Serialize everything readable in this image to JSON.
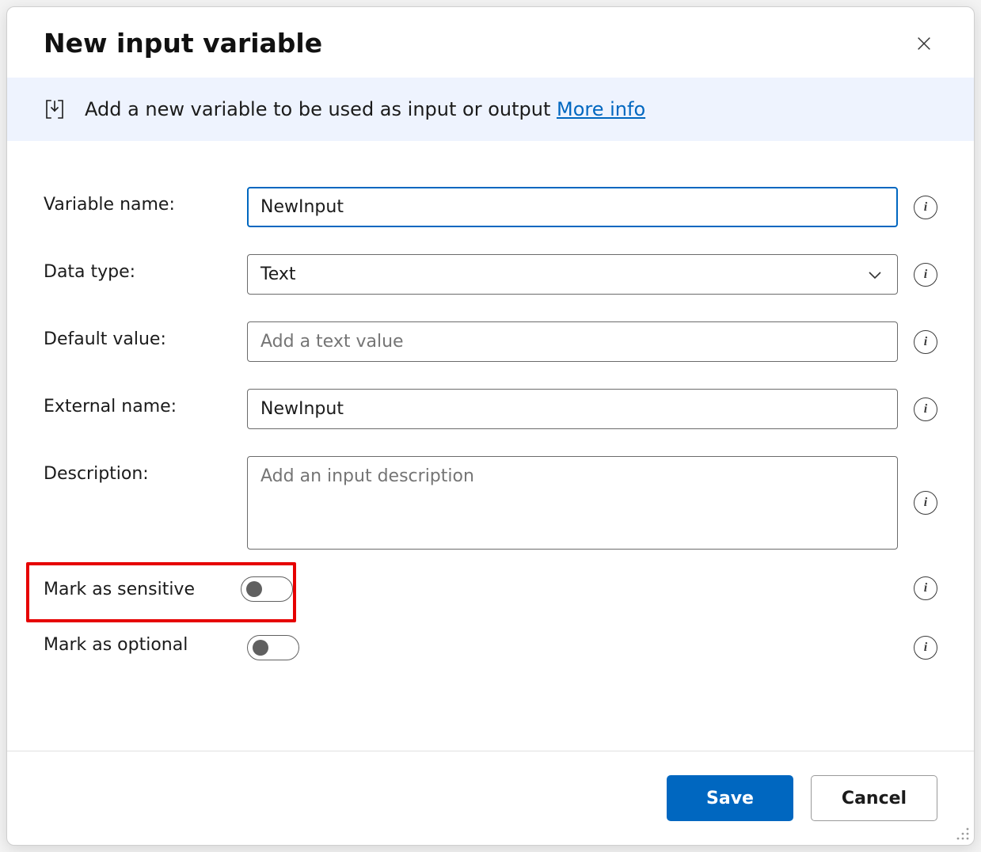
{
  "dialog": {
    "title": "New input variable"
  },
  "banner": {
    "text": "Add a new variable to be used as input or output ",
    "more_info": "More info"
  },
  "form": {
    "variable_name": {
      "label": "Variable name:",
      "value": "NewInput"
    },
    "data_type": {
      "label": "Data type:",
      "value": "Text"
    },
    "default_value": {
      "label": "Default value:",
      "value": "",
      "placeholder": "Add a text value"
    },
    "external_name": {
      "label": "External name:",
      "value": "NewInput"
    },
    "description": {
      "label": "Description:",
      "value": "",
      "placeholder": "Add an input description"
    },
    "mark_sensitive": {
      "label": "Mark as sensitive",
      "on": false
    },
    "mark_optional": {
      "label": "Mark as optional",
      "on": false
    }
  },
  "buttons": {
    "save": "Save",
    "cancel": "Cancel"
  },
  "info_glyph": "i"
}
